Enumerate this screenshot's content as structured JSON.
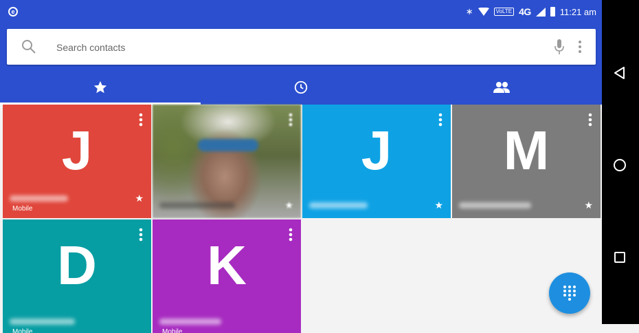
{
  "status_bar": {
    "app_icon": "e",
    "volte_label": "VoLTE",
    "network": "4G",
    "time": "11:21 am"
  },
  "search": {
    "placeholder": "Search contacts"
  },
  "tabs": [
    {
      "name": "favorites",
      "icon": "star-icon",
      "active": true
    },
    {
      "name": "recents",
      "icon": "clock-icon",
      "active": false
    },
    {
      "name": "contacts",
      "icon": "people-icon",
      "active": false
    }
  ],
  "favorites": [
    {
      "letter": "J",
      "color": "#e0463b",
      "type": "Mobile",
      "starred": true
    },
    {
      "letter": "",
      "color": "#7a8a4e",
      "type": "",
      "starred": true,
      "photo": true
    },
    {
      "letter": "J",
      "color": "#0ea2e4",
      "type": "",
      "starred": true
    },
    {
      "letter": "M",
      "color": "#7c7c7c",
      "type": "",
      "starred": true
    },
    {
      "letter": "D",
      "color": "#079ea3",
      "type": "Mobile",
      "starred": false
    },
    {
      "letter": "K",
      "color": "#a72bc0",
      "type": "Mobile",
      "starred": false
    }
  ],
  "colors": {
    "primary": "#2b4fcf",
    "fab": "#1e8fe0"
  }
}
